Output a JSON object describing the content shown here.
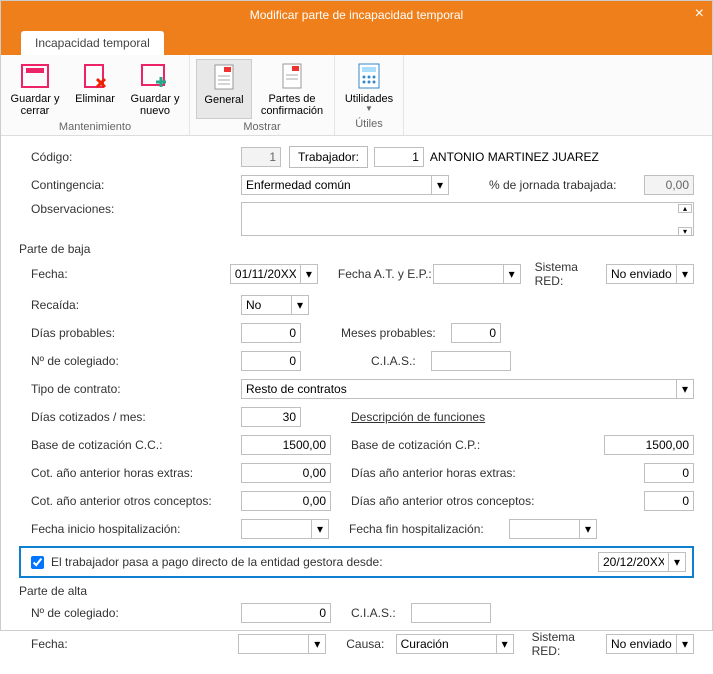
{
  "window": {
    "title": "Modificar parte de incapacidad temporal"
  },
  "tab": {
    "label": "Incapacidad temporal"
  },
  "ribbon": {
    "mantenimiento": {
      "title": "Mantenimiento",
      "save_close": "Guardar y cerrar",
      "delete": "Eliminar",
      "save_new": "Guardar y nuevo"
    },
    "mostrar": {
      "title": "Mostrar",
      "general": "General",
      "partes": "Partes de confirmación"
    },
    "utiles": {
      "title": "Útiles",
      "utilidades": "Utilidades"
    }
  },
  "form": {
    "codigo_label": "Código:",
    "codigo_value": "1",
    "trabajador_btn": "Trabajador:",
    "trabajador_num": "1",
    "trabajador_name": "ANTONIO MARTINEZ JUAREZ",
    "contingencia_label": "Contingencia:",
    "contingencia_value": "Enfermedad común",
    "jornada_label": "% de jornada trabajada:",
    "jornada_value": "0,00",
    "observaciones_label": "Observaciones:"
  },
  "baja": {
    "section": "Parte de baja",
    "fecha_label": "Fecha:",
    "fecha_value": "01/11/20XX",
    "fecha_at_label": "Fecha A.T. y E.P.:",
    "sistema_red_label": "Sistema RED:",
    "sistema_red_value": "No enviado",
    "recaida_label": "Recaída:",
    "recaida_value": "No",
    "dias_prob_label": "Días probables:",
    "dias_prob_value": "0",
    "meses_prob_label": "Meses probables:",
    "meses_prob_value": "0",
    "colegiado_label": "Nº de colegiado:",
    "colegiado_value": "0",
    "cias_label": "C.I.A.S.:",
    "tipo_contrato_label": "Tipo de contrato:",
    "tipo_contrato_value": "Resto de contratos",
    "dias_cotiz_label": "Días cotizados / mes:",
    "dias_cotiz_value": "30",
    "desc_func_label": "Descripción de funciones",
    "base_cc_label": "Base de cotización C.C.:",
    "base_cc_value": "1500,00",
    "base_cp_label": "Base de cotización C.P.:",
    "base_cp_value": "1500,00",
    "cot_horas_label": "Cot. año anterior horas extras:",
    "cot_horas_value": "0,00",
    "dias_horas_label": "Días año anterior horas extras:",
    "dias_horas_value": "0",
    "cot_otros_label": "Cot. año anterior otros conceptos:",
    "cot_otros_value": "0,00",
    "dias_otros_label": "Días año anterior otros conceptos:",
    "dias_otros_value": "0",
    "hosp_ini_label": "Fecha inicio hospitalización:",
    "hosp_fin_label": "Fecha fin hospitalización:",
    "pago_directo_label": "El trabajador pasa a pago directo de la entidad gestora desde:",
    "pago_directo_value": "20/12/20XX"
  },
  "alta": {
    "section": "Parte de alta",
    "colegiado_label": "Nº de colegiado:",
    "colegiado_value": "0",
    "cias_label": "C.I.A.S.:",
    "fecha_label": "Fecha:",
    "causa_label": "Causa:",
    "causa_value": "Curación",
    "sistema_red_label": "Sistema RED:",
    "sistema_red_value": "No enviado"
  }
}
